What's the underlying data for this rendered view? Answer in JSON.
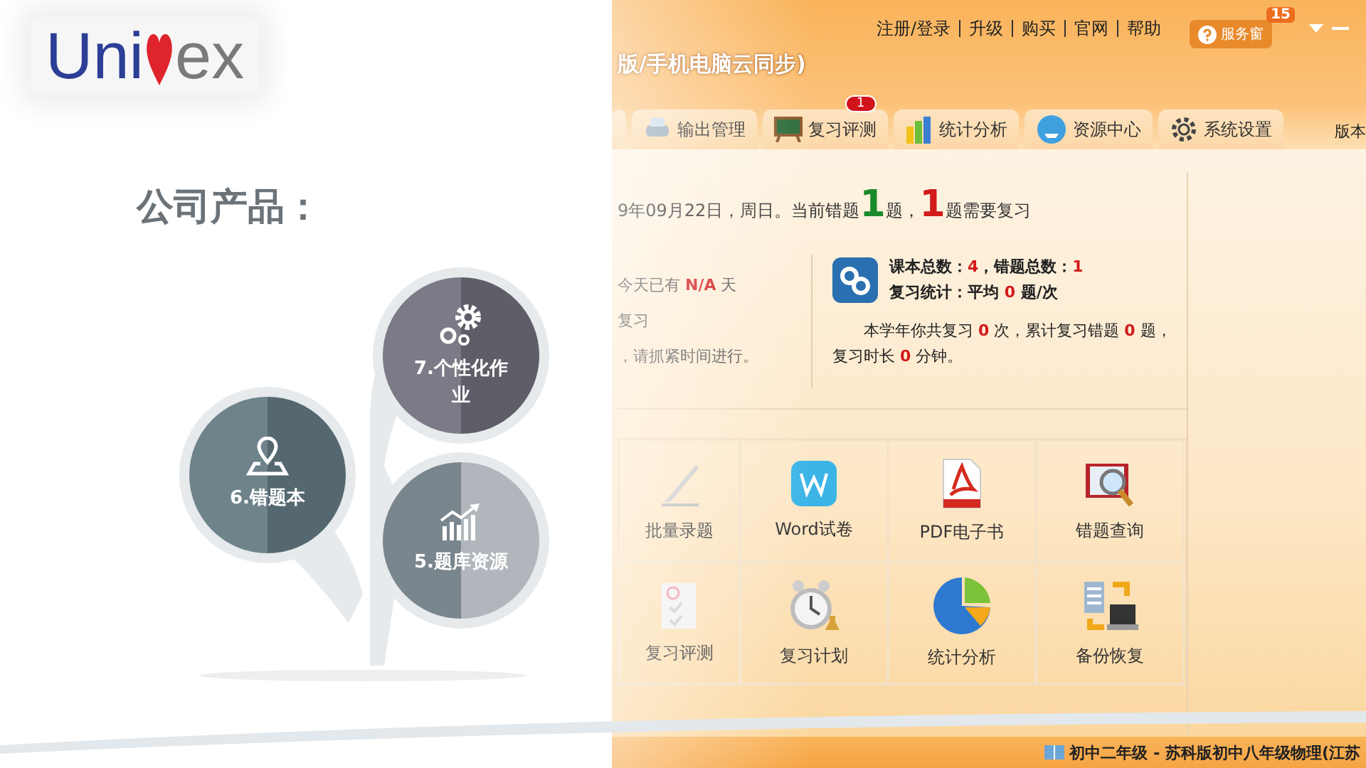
{
  "logo": {
    "left": "Uni",
    "right": "ex"
  },
  "heading": "公司产品：",
  "products": [
    {
      "label": "7.个性化作业",
      "kind": "gears"
    },
    {
      "label": "6.错题本",
      "kind": "pin"
    },
    {
      "label": "5.题库资源",
      "kind": "chart"
    }
  ],
  "app": {
    "title": "版/手机电脑云同步)",
    "top_links": [
      "注册/登录",
      "升级",
      "购买",
      "官网",
      "帮助"
    ],
    "service_button": {
      "label": "服务窗",
      "badge": "15"
    },
    "tabs": [
      {
        "label": "输出管理",
        "kind": "printer"
      },
      {
        "label": "复习评测",
        "kind": "board",
        "badge": "1"
      },
      {
        "label": "统计分析",
        "kind": "bars"
      },
      {
        "label": "资源中心",
        "kind": "cloud"
      },
      {
        "label": "系统设置",
        "kind": "gear"
      }
    ],
    "version_label": "版本",
    "summary": [
      {
        "text": "9年09月22日，周日。当前错题 ",
        "kind": "plain"
      },
      {
        "text": "1",
        "kind": "big-green"
      },
      {
        "text": " 题， ",
        "kind": "plain"
      },
      {
        "text": "1",
        "kind": "big-red"
      },
      {
        "text": " 题需要复习",
        "kind": "plain"
      }
    ],
    "left_notes": [
      [
        {
          "text": "今天已有 ",
          "kind": "plain"
        },
        {
          "text": "N/A",
          "kind": "red"
        },
        {
          "text": " 天",
          "kind": "plain"
        }
      ],
      [
        {
          "text": "复习",
          "kind": "plain"
        }
      ],
      [
        {
          "text": "，请抓紧时间进行。",
          "kind": "plain"
        }
      ]
    ],
    "stats": [
      [
        {
          "text": "课本总数：",
          "kind": "plain"
        },
        {
          "text": "4",
          "kind": "red"
        },
        {
          "text": "，错题总数：",
          "kind": "plain"
        },
        {
          "text": "1",
          "kind": "red"
        }
      ],
      [
        {
          "text": "复习统计：平均 ",
          "kind": "plain"
        },
        {
          "text": "0",
          "kind": "red"
        },
        {
          "text": " 题/次",
          "kind": "plain"
        }
      ]
    ],
    "review_note": [
      {
        "text": "本学年你共复习 ",
        "kind": "plain"
      },
      {
        "text": "0",
        "kind": "red"
      },
      {
        "text": " 次，累计复习错题 ",
        "kind": "plain"
      },
      {
        "text": "0",
        "kind": "red"
      },
      {
        "text": " 题，复习时长 ",
        "kind": "plain"
      },
      {
        "text": "0",
        "kind": "red"
      },
      {
        "text": " 分钟。",
        "kind": "plain"
      }
    ],
    "tools": [
      {
        "label": "批量录题",
        "kind": "pen"
      },
      {
        "label": "Word试卷",
        "kind": "word"
      },
      {
        "label": "PDF电子书",
        "kind": "pdf"
      },
      {
        "label": "错题查询",
        "kind": "book"
      },
      {
        "label": "复习评测",
        "kind": "sheet"
      },
      {
        "label": "复习计划",
        "kind": "clock"
      },
      {
        "label": "统计分析",
        "kind": "pie"
      },
      {
        "label": "备份恢复",
        "kind": "backup"
      }
    ],
    "status_bar": "初中二年级 - 苏科版初中八年级物理(江苏"
  }
}
